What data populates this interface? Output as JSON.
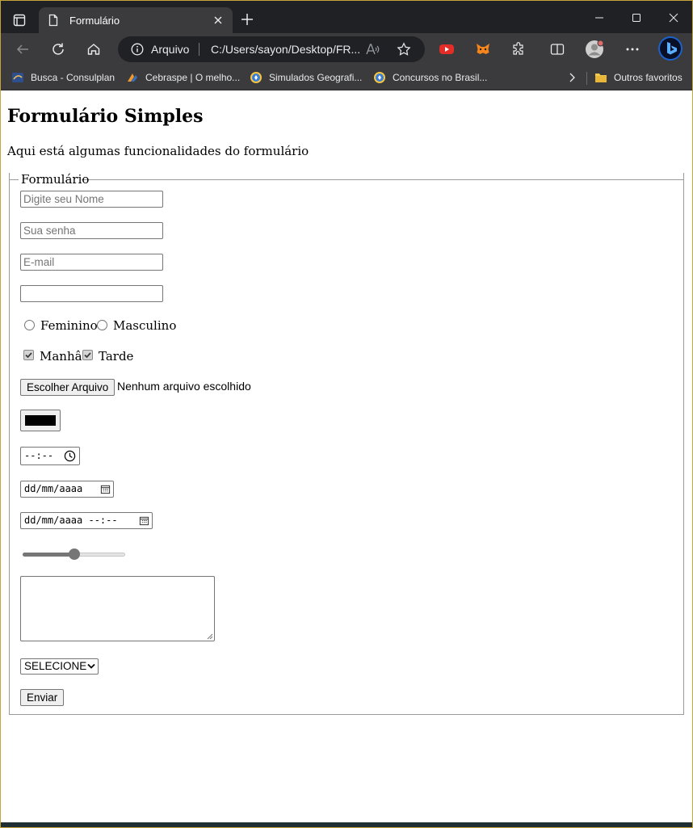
{
  "browser": {
    "tab": {
      "title": "Formulário"
    },
    "address": {
      "security_label": "Arquivo",
      "url": "C:/Users/sayon/Desktop/FR..."
    },
    "bookmarks": [
      {
        "label": "Busca - Consulplan"
      },
      {
        "label": "Cebraspe | O melho..."
      },
      {
        "label": "Simulados Geografi..."
      },
      {
        "label": "Concursos no Brasil..."
      }
    ],
    "other_favorites": "Outros favoritos"
  },
  "page": {
    "title": "Formulário Simples",
    "description": "Aqui está algumas funcionalidades do formulário"
  },
  "form": {
    "legend": "Formulário",
    "name_placeholder": "Digite seu Nome",
    "password_placeholder": "Sua senha",
    "email_placeholder": "E-mail",
    "blank_value": "",
    "radio_female": "Feminino",
    "radio_male": "Masculino",
    "check_morning": "Manhâ",
    "check_afternoon": "Tarde",
    "file_button": "Escolher Arquivo",
    "file_status": "Nenhum arquivo escolhido",
    "color_value": "#000000",
    "time_placeholder": "--:--",
    "date_placeholder": "dd/mm/aaaa",
    "datetime_placeholder": "dd/mm/aaaa --:--",
    "range_value_fraction": 0.5,
    "select_value": "SELECIONE",
    "submit_label": "Enviar"
  }
}
